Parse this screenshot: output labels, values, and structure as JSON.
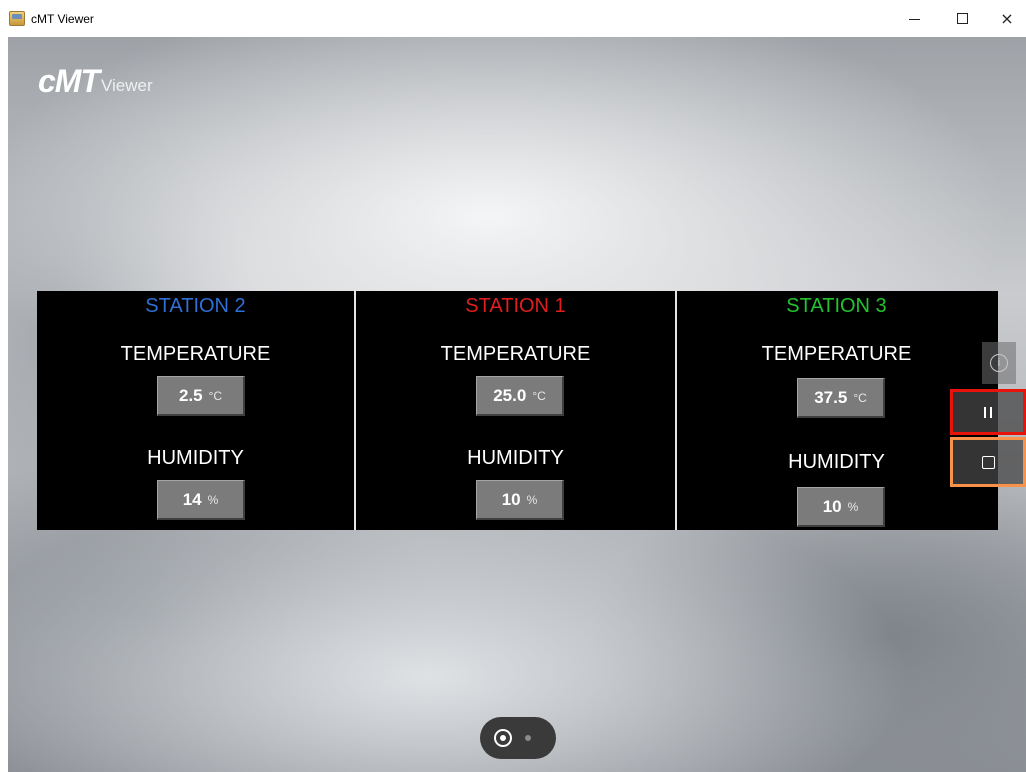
{
  "window": {
    "title": "cMT Viewer",
    "minimize_glyph": "",
    "close_glyph": "×"
  },
  "logo": {
    "main": "cMT",
    "sub": "Viewer"
  },
  "stations": [
    {
      "title": "STATION 2",
      "title_color": "#2f6fd6",
      "temperature_label": "TEMPERATURE",
      "temperature_value": "2.5",
      "temperature_unit": "°C",
      "humidity_label": "HUMIDITY",
      "humidity_value": "14",
      "humidity_unit": "%"
    },
    {
      "title": "STATION 1",
      "title_color": "#e01e1e",
      "temperature_label": "TEMPERATURE",
      "temperature_value": "25.0",
      "temperature_unit": "°C",
      "humidity_label": "HUMIDITY",
      "humidity_value": "10",
      "humidity_unit": "%"
    },
    {
      "title": "STATION 3",
      "title_color": "#22c32e",
      "temperature_label": "TEMPERATURE",
      "temperature_value": "37.5",
      "temperature_unit": "°C",
      "humidity_label": "HUMIDITY",
      "humidity_value": "10",
      "humidity_unit": "%"
    }
  ],
  "side_controls": {
    "info_icon": "info-icon",
    "pause_icon": "pause-icon",
    "stop_icon": "stop-icon",
    "pause_highlight_color": "#e8140c",
    "stop_highlight_color": "#f7924a"
  },
  "pager": {
    "current_page": 1,
    "total_pages": 2
  }
}
